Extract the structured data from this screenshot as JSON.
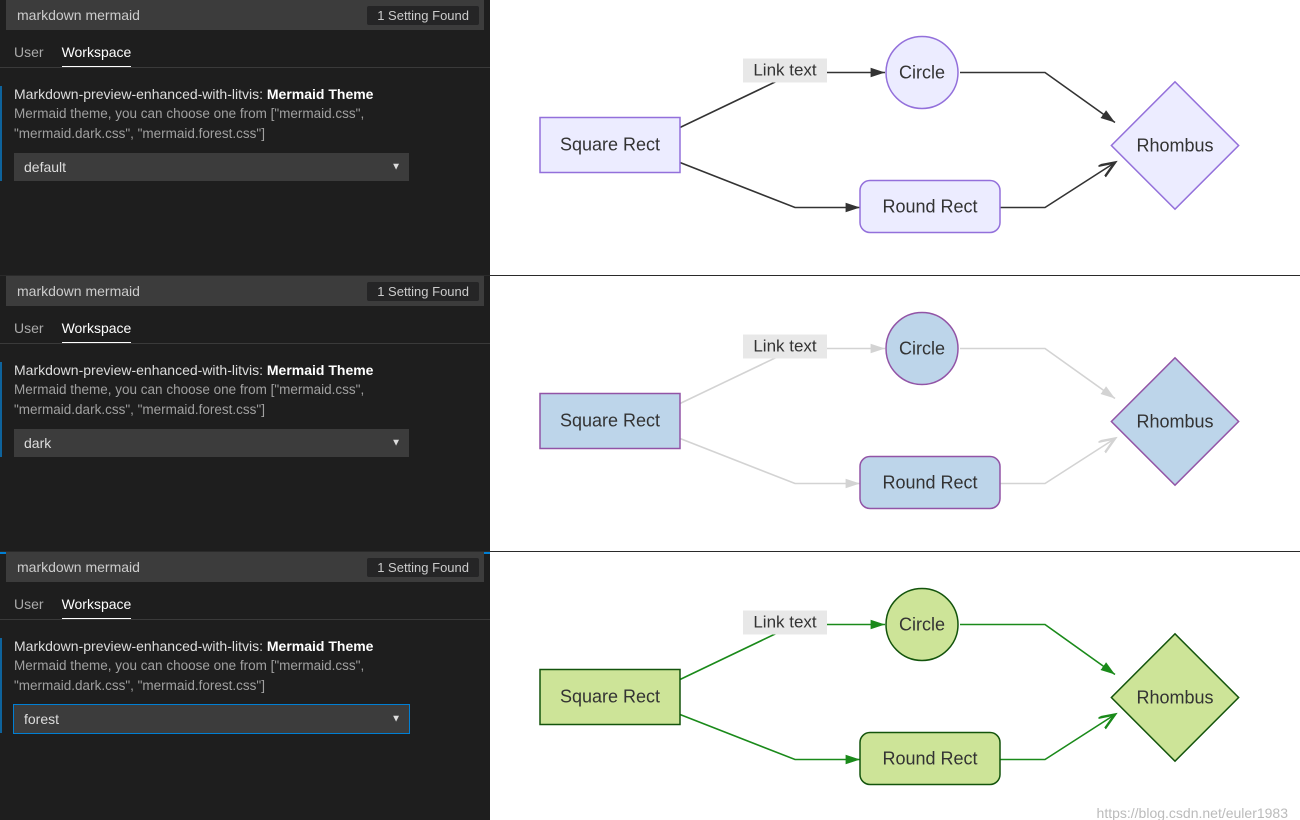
{
  "panels": [
    {
      "search_value": "markdown mermaid",
      "badge": "1 Setting Found",
      "tabs": {
        "user": "User",
        "workspace": "Workspace",
        "active": "workspace"
      },
      "setting": {
        "ext": "Markdown-preview-enhanced-with-litvis:",
        "name": "Mermaid Theme",
        "desc": "Mermaid theme, you can choose one from [\"mermaid.css\", \"mermaid.dark.css\", \"mermaid.forest.css\"]",
        "value": "default",
        "modified": true,
        "focused": false
      },
      "selected_row": false,
      "diagram_theme": "default"
    },
    {
      "search_value": "markdown mermaid",
      "badge": "1 Setting Found",
      "tabs": {
        "user": "User",
        "workspace": "Workspace",
        "active": "workspace"
      },
      "setting": {
        "ext": "Markdown-preview-enhanced-with-litvis:",
        "name": "Mermaid Theme",
        "desc": "Mermaid theme, you can choose one from [\"mermaid.css\", \"mermaid.dark.css\", \"mermaid.forest.css\"]",
        "value": "dark",
        "modified": true,
        "focused": false
      },
      "selected_row": false,
      "diagram_theme": "dark"
    },
    {
      "search_value": "markdown mermaid",
      "badge": "1 Setting Found",
      "tabs": {
        "user": "User",
        "workspace": "Workspace",
        "active": "workspace"
      },
      "setting": {
        "ext": "Markdown-preview-enhanced-with-litvis:",
        "name": "Mermaid Theme",
        "desc": "Mermaid theme, you can choose one from [\"mermaid.css\", \"mermaid.dark.css\", \"mermaid.forest.css\"]",
        "value": "forest",
        "modified": true,
        "focused": true
      },
      "selected_row": true,
      "diagram_theme": "forest"
    }
  ],
  "diagram": {
    "link_label": "Link text",
    "nodes": {
      "square": "Square Rect",
      "circle": "Circle",
      "round": "Round Rect",
      "rhombus": "Rhombus"
    },
    "themes": {
      "default": {
        "fill": "#ECECFF",
        "stroke": "#9370DB",
        "edge": "#333333",
        "text": "#333333",
        "label_bg": "#e8e8e8"
      },
      "dark": {
        "fill": "#BDD5EA",
        "stroke": "#9254A6",
        "edge": "#d3d3d3",
        "text": "#333333",
        "label_bg": "#e8e8e8"
      },
      "forest": {
        "fill": "#cde498",
        "stroke": "#13540c",
        "edge": "#1a8a1a",
        "text": "#333333",
        "label_bg": "#e8e8e8"
      }
    }
  },
  "watermark": "https://blog.csdn.net/euler1983"
}
